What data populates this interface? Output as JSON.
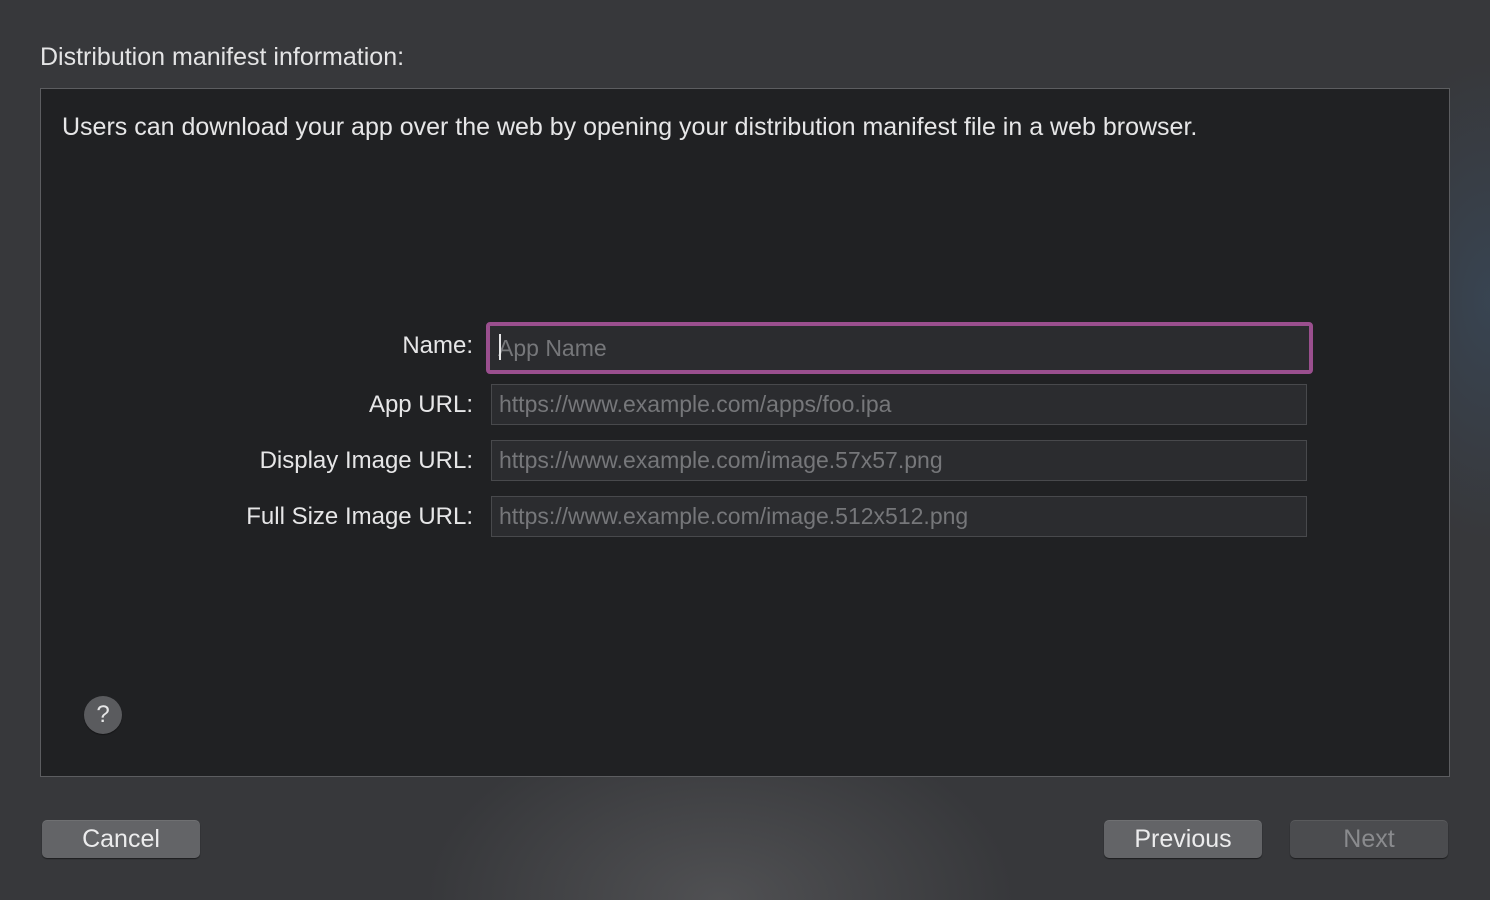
{
  "sheet": {
    "title": "Distribution manifest information:"
  },
  "panel": {
    "description": "Users can download your app over the web by opening your distribution manifest file in a web browser."
  },
  "form": {
    "fields": [
      {
        "label": "Name:",
        "value": "",
        "placeholder": "App Name",
        "focused": true
      },
      {
        "label": "App URL:",
        "value": "",
        "placeholder": "https://www.example.com/apps/foo.ipa"
      },
      {
        "label": "Display Image URL:",
        "value": "",
        "placeholder": "https://www.example.com/image.57x57.png"
      },
      {
        "label": "Full Size Image URL:",
        "value": "",
        "placeholder": "https://www.example.com/image.512x512.png"
      }
    ]
  },
  "help": {
    "label": "?",
    "icon": "question-mark-icon"
  },
  "buttons": {
    "cancel": "Cancel",
    "previous": "Previous",
    "next": "Next",
    "next_enabled": false
  },
  "colors": {
    "focus_ring": "#9a4f8e",
    "panel_background": "#202123",
    "window_background": "#37383b"
  }
}
